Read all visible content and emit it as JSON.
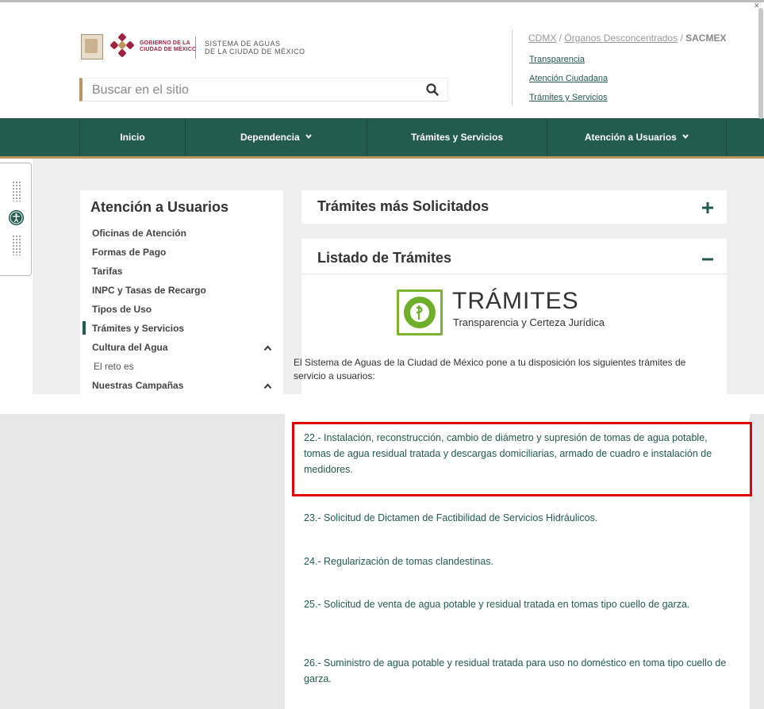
{
  "header": {
    "gob_text_line1": "GOBIERNO DE LA",
    "gob_text_line2": "CIUDAD DE MÉXICO",
    "sacmex_line1": "SISTEMA DE AGUAS",
    "sacmex_line2": "DE LA CIUDAD DE MÉXICO",
    "search_placeholder": "Buscar en el sitio",
    "breadcrumb": {
      "cdmx": "CDMX",
      "sep1": " / ",
      "organos": "Órganos Desconcentrados",
      "sep2": " / ",
      "current": "SACMEX"
    },
    "links": {
      "transparencia": "Transparencia",
      "atencion": "Atención Ciudadana",
      "tramites": "Trámites y Servicios"
    }
  },
  "nav": {
    "items": [
      {
        "label": "Inicio"
      },
      {
        "label": "Dependencia"
      },
      {
        "label": "Trámites y Servicios"
      },
      {
        "label": "Atención a Usuarios"
      }
    ]
  },
  "sidebar": {
    "title": "Atención a Usuarios",
    "items": [
      {
        "label": "Oficinas de Atención"
      },
      {
        "label": "Formas de Pago"
      },
      {
        "label": "Tarifas"
      },
      {
        "label": "INPC y Tasas de Recargo"
      },
      {
        "label": "Tipos de Uso"
      },
      {
        "label": "Trámites y Servicios"
      },
      {
        "label": "Cultura del Agua"
      },
      {
        "label": "El reto es"
      },
      {
        "label": "Nuestras Campañas"
      }
    ]
  },
  "panels": {
    "mas_solicitados": "Trámites más Solicitados",
    "listado": "Listado de Trámites",
    "logo_big": "TRÁMITES",
    "logo_small": "Transparencia y Certeza Jurídica",
    "intro": "El Sistema de Aguas de la Ciudad de México pone a tu disposición los siguientes trámites de servicio a usuarios:"
  },
  "tramites": [
    {
      "text": "22.- Instalación, reconstrucción, cambio de diámetro y supresión de tomas de agua potable, tomas de agua residual tratada y descargas domiciliarias, armado de cuadro e instalación de medidores."
    },
    {
      "text": "23.- Solicitud de Dictamen de Factibilidad de Servicios Hidráulicos."
    },
    {
      "text": "24.- Regularización de tomas clandestinas."
    },
    {
      "text": "25.- Solicitud de venta de agua potable y residual tratada en tomas tipo cuello de garza."
    },
    {
      "text": "26.- Suministro de agua potable y residual tratada para uso no  doméstico en toma tipo cuello de garza."
    }
  ],
  "colors": {
    "primary": "#235b4e",
    "gold": "#bc955c",
    "gob": "#9f2241",
    "highlight": "#e00000"
  }
}
